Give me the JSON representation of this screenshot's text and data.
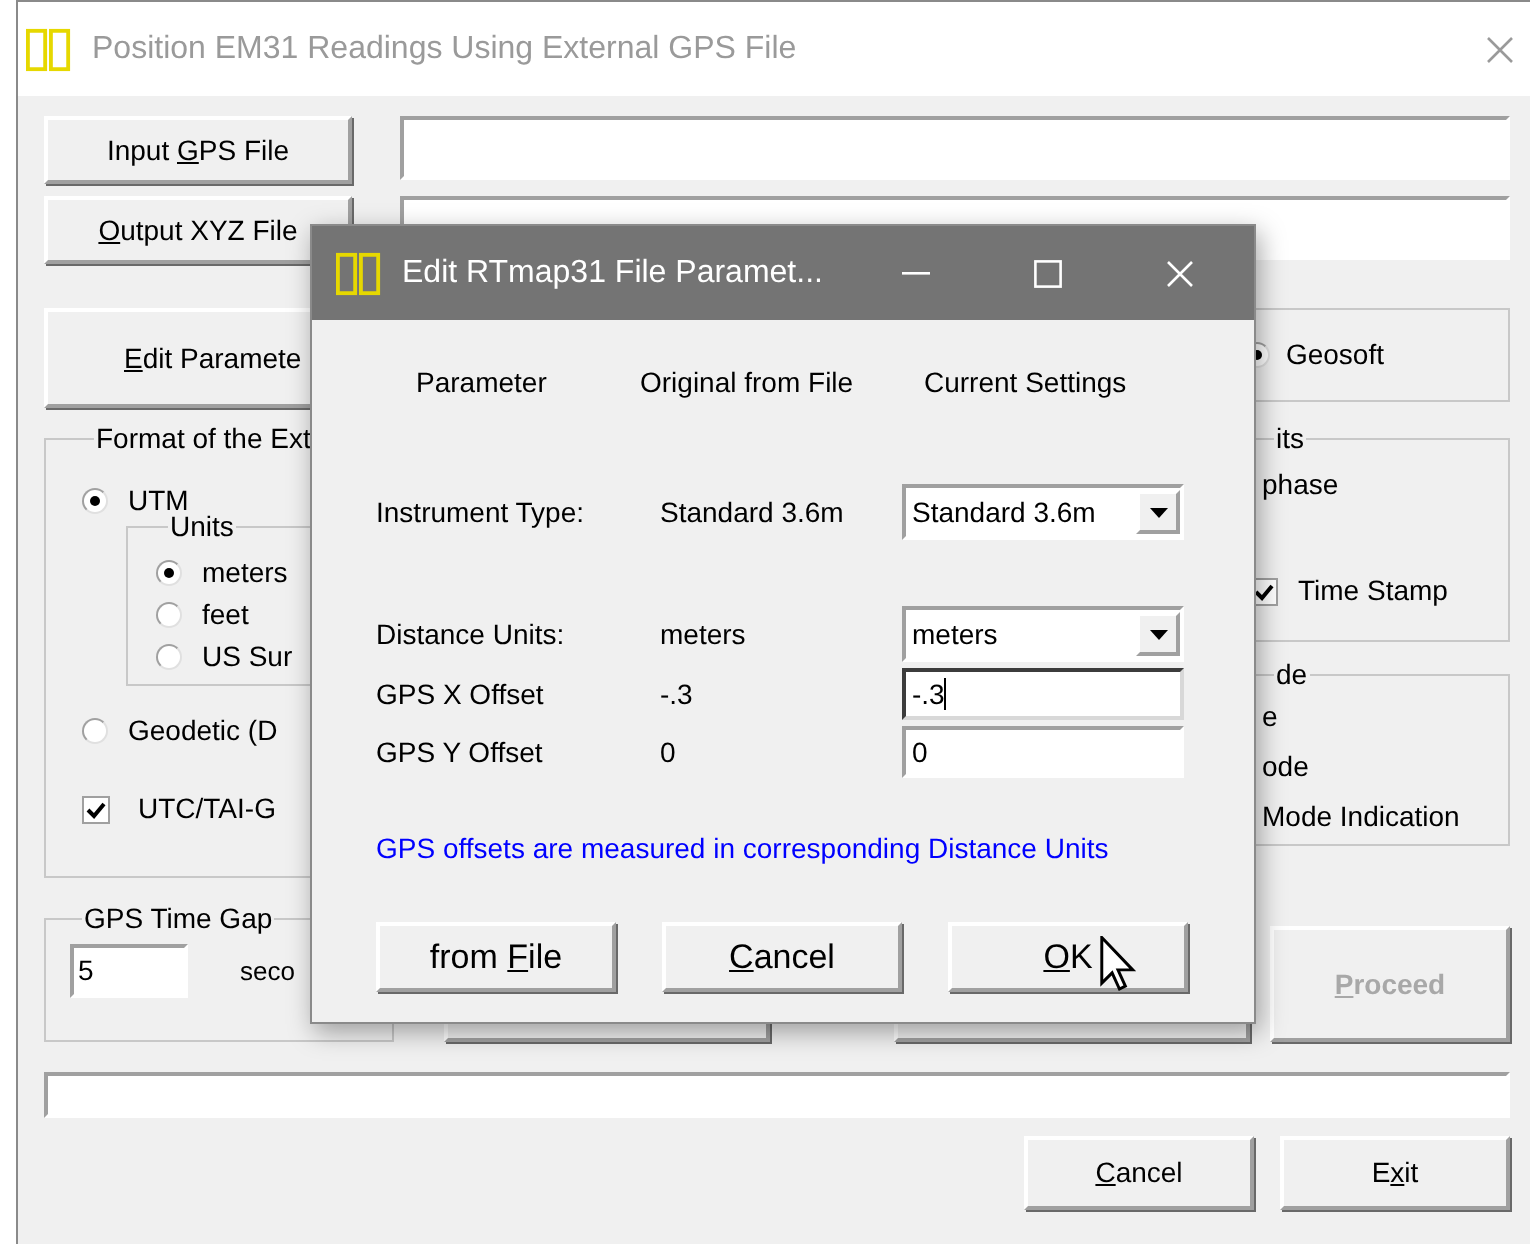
{
  "window": {
    "title": "Position EM31 Readings Using External GPS File"
  },
  "file_buttons": [
    {
      "pre": "Input ",
      "key": "G",
      "post": "PS File"
    },
    {
      "key": "O",
      "post": "utput XYZ File"
    }
  ],
  "edit_button": {
    "key": "E",
    "post": "dit Paramete"
  },
  "output_format": {
    "options": [
      {
        "label": "Geosoft",
        "selected": true
      }
    ]
  },
  "format_group": {
    "title": "Format of the Ext",
    "options": [
      {
        "label": "UTM",
        "selected": true
      },
      {
        "label": "Geodetic (D",
        "selected": false
      }
    ],
    "units": {
      "title": "Units",
      "options": [
        {
          "label": "meters",
          "selected": true
        },
        {
          "label": "feet",
          "selected": false
        },
        {
          "label": "US Sur",
          "selected": false
        }
      ]
    },
    "utc": {
      "label": "UTC/TAI-G",
      "checked": true
    }
  },
  "right_groups": [
    {
      "title": "its",
      "items": [
        {
          "kind": "text",
          "label": "phase"
        },
        {
          "kind": "checkbox",
          "label": "Time Stamp",
          "checked": true
        }
      ]
    },
    {
      "title": "de",
      "items": [
        {
          "kind": "text",
          "label": "e"
        },
        {
          "kind": "text",
          "label": "ode"
        },
        {
          "kind": "text",
          "label": "Mode Indication"
        }
      ]
    }
  ],
  "time_gap": {
    "title": "GPS Time Gap",
    "value": "5",
    "unit": "seco"
  },
  "progress": {
    "level": 0
  },
  "proceed": {
    "key": "P",
    "post": "roceed",
    "disabled": true
  },
  "bottom_buttons": [
    {
      "key": "C",
      "post": "ancel"
    },
    {
      "pre": "E",
      "key": "x",
      "post": "it"
    }
  ],
  "dialog": {
    "title": "Edit RTmap31 File Paramet...",
    "columns": [
      "Parameter",
      "Original from File",
      "Current Settings"
    ],
    "rows": [
      {
        "kind": "select",
        "label": "Instrument Type:",
        "original": "Standard 3.6m",
        "value": "Standard 3.6m"
      },
      {
        "kind": "select",
        "label": "Distance Units:",
        "original": "meters",
        "value": "meters"
      },
      {
        "kind": "input",
        "label": "GPS X Offset",
        "original": "-.3",
        "value": "-.3",
        "focused": true
      },
      {
        "kind": "input",
        "label": "GPS Y Offset",
        "original": "0",
        "value": "0",
        "focused": false
      }
    ],
    "note": "GPS offsets are measured in corresponding Distance Units",
    "buttons": [
      {
        "pre": "from ",
        "key": "F",
        "post": "ile"
      },
      {
        "key": "C",
        "post": "ancel"
      },
      {
        "key": "O",
        "post": "K"
      }
    ]
  }
}
